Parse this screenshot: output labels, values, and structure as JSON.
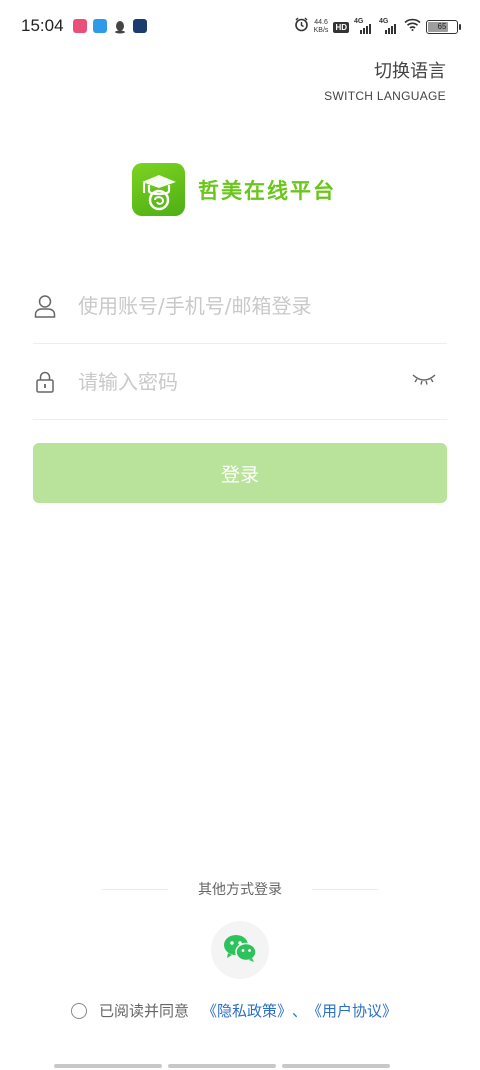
{
  "status": {
    "time": "15:04",
    "net_speed_value": "44.6",
    "net_speed_unit": "KB/s",
    "hd_label": "HD",
    "network_1": "4G",
    "network_2": "4G",
    "battery": "65",
    "battery_level": 0.65
  },
  "language": {
    "cn": "切换语言",
    "en": "SWITCH LANGUAGE"
  },
  "brand": {
    "name": "哲美在线平台",
    "color": "#6cc51d"
  },
  "login": {
    "account_placeholder": "使用账号/手机号/邮箱登录",
    "password_placeholder": "请输入密码",
    "submit_label": "登录",
    "button_color": "#b9e29b"
  },
  "other_login": {
    "label": "其他方式登录",
    "wechat_icon": "wechat-icon"
  },
  "agreement": {
    "prefix": "已阅读并同意",
    "privacy_link": "《隐私政策》",
    "separator": "、",
    "terms_link": "《用户协议》",
    "link_color": "#2a70c8"
  }
}
